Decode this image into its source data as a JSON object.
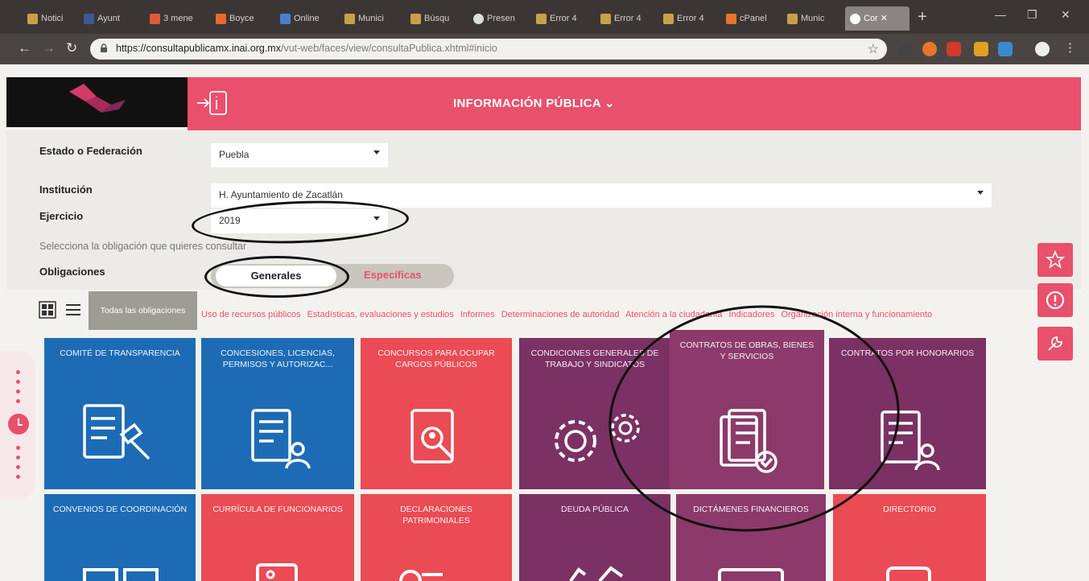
{
  "browser": {
    "tabs": [
      "Notici",
      "Ayunt",
      "3 mene",
      "Boyce",
      "Online",
      "Munici",
      "Búsqu",
      "Presen",
      "Error 4",
      "Error 4",
      "Error 4",
      "cPanel",
      "Munic",
      "Cor"
    ],
    "url_domain": "https://consultapublicamx.inai.org.mx",
    "url_path": "/vut-web/faces/view/consultaPublica.xhtml#inicio"
  },
  "header": {
    "title": "INFORMACIÓN PÚBLICA"
  },
  "form": {
    "estado_label": "Estado o Federación",
    "estado_value": "Puebla",
    "institucion_label": "Institución",
    "institucion_value": "H. Ayuntamiento de Zacatlán",
    "ejercicio_label": "Ejercicio",
    "ejercicio_value": "2019",
    "hint": "Selecciona la obligación que quieres consultar",
    "obligaciones_label": "Obligaciones",
    "tab_generales": "Generales",
    "tab_especificas": "Específicas"
  },
  "filters": {
    "all": "Todas las obligaciones",
    "items": [
      "Uso de recursos públicos",
      "Estadísticas, evaluaciones y estudios",
      "Informes",
      "Determinaciones de autoridad",
      "Atención a la ciudadanía",
      "Indicadores",
      "Organización interna y funcionamiento"
    ]
  },
  "tiles": [
    {
      "label": "Comité de transparencia"
    },
    {
      "label": "Concesiones, licencias, permisos y autorizac..."
    },
    {
      "label": "Concursos para ocupar cargos públicos"
    },
    {
      "label": "Condiciones generales de trabajo y sindicatos"
    },
    {
      "label": "Contratos de obras, bienes y servicios"
    },
    {
      "label": "Contratos por honorarios"
    },
    {
      "label": "Convenios de coordinación"
    },
    {
      "label": "Currícula de funcionarios"
    },
    {
      "label": "Declaraciones patrimoniales"
    },
    {
      "label": "Deuda pública"
    },
    {
      "label": "Dictámenes financieros"
    },
    {
      "label": "Directorio"
    }
  ],
  "colors": {
    "brand_pink": "#e9506b",
    "tile_blue": "#1d6bb5",
    "tile_red": "#ea4b55",
    "tile_purple": "#7b3164"
  }
}
